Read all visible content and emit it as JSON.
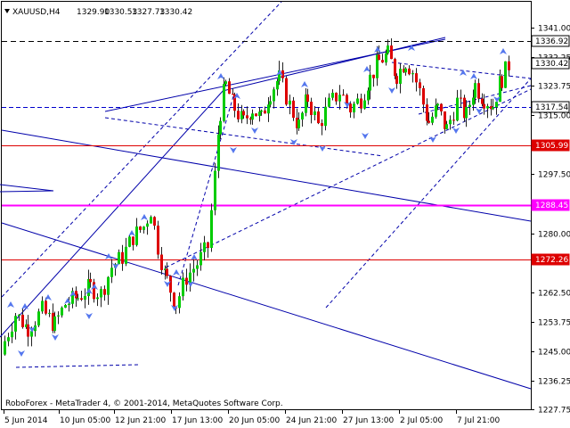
{
  "chart_data": {
    "type": "candlestick",
    "header": {
      "symbol": "XAUUSD,H4",
      "open": "1329.90",
      "high": "1330.53",
      "low": "1327.73",
      "close": "1330.42"
    },
    "footer": "RoboForex - MetaTrader 4, © 2001-2014, MetaQuotes Software Corp.",
    "ylim": [
      1222,
      1346
    ],
    "y_ticks": [
      {
        "value": 1341.0,
        "label": "1341.00"
      },
      {
        "value": 1332.25,
        "label": "1332.25"
      },
      {
        "value": 1323.75,
        "label": "1323.75"
      },
      {
        "value": 1315.0,
        "label": "1315.00"
      },
      {
        "value": 1297.5,
        "label": "1297.50"
      },
      {
        "value": 1280.0,
        "label": "1280.00"
      },
      {
        "value": 1262.5,
        "label": "1262.50"
      },
      {
        "value": 1253.75,
        "label": "1253.75"
      },
      {
        "value": 1245.0,
        "label": "1245.00"
      },
      {
        "value": 1236.25,
        "label": "1236.25"
      },
      {
        "value": 1227.75,
        "label": "1227.75"
      }
    ],
    "x_ticks": [
      "5 Jun 2014",
      "10 Jun 05:00",
      "12 Jun 21:00",
      "17 Jun 13:00",
      "20 Jun 05:00",
      "24 Jun 21:00",
      "27 Jun 13:00",
      "2 Jul 05:00",
      "7 Jul 21:00"
    ],
    "levels": [
      {
        "value": 1336.92,
        "label": "1336.92",
        "style": "dash",
        "color": "#000000"
      },
      {
        "value": 1330.42,
        "label": "1330.42",
        "style": "current",
        "color": "#000000"
      },
      {
        "value": 1317.54,
        "label": "1317.54",
        "style": "dash-blue",
        "color": "#0000cc"
      },
      {
        "value": 1305.99,
        "label": "1305.99",
        "style": "red",
        "color": "#dd0000"
      },
      {
        "value": 1288.45,
        "label": "1288.45",
        "style": "magenta",
        "color": "#ff00ff"
      },
      {
        "value": 1272.26,
        "label": "1272.26",
        "style": "red",
        "color": "#dd0000"
      }
    ],
    "colors": {
      "bull": "#00cc00",
      "bear": "#dd0000",
      "trend": "#0000aa",
      "fractal": "#5577ee"
    }
  }
}
